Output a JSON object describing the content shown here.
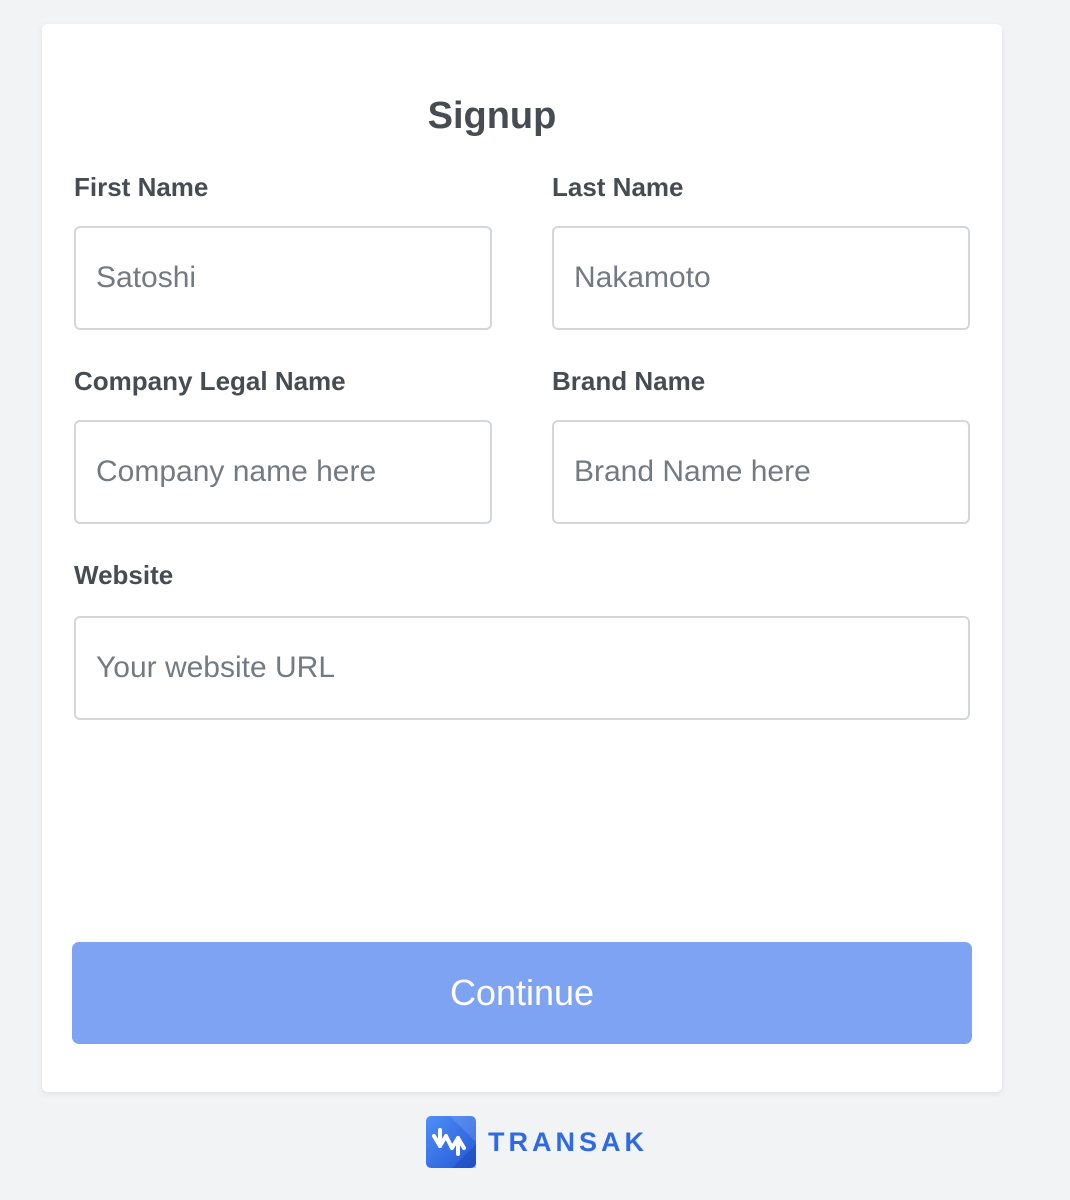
{
  "form": {
    "title": "Signup",
    "fields": [
      {
        "label": "First Name",
        "placeholder": "Satoshi",
        "value": ""
      },
      {
        "label": "Last Name",
        "placeholder": "Nakamoto",
        "value": ""
      },
      {
        "label": "Company Legal Name",
        "placeholder": "Company name here",
        "value": ""
      },
      {
        "label": "Brand Name",
        "placeholder": "Brand Name here",
        "value": ""
      },
      {
        "label": "Website",
        "placeholder": "Your website URL",
        "value": ""
      }
    ],
    "continue_label": "Continue"
  },
  "footer": {
    "brand_name": "TRANSAK",
    "logo_icon": "transak-logo-icon"
  },
  "colors": {
    "page_background": "#f2f3f5",
    "card_background": "#ffffff",
    "text": "#474c53",
    "button_background": "#7ea3f3",
    "brand": "#2f6ae6"
  }
}
